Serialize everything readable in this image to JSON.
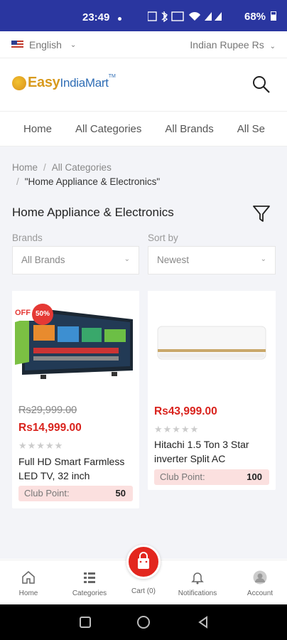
{
  "status_bar": {
    "time": "23:49",
    "battery": "68%",
    "icons": [
      "notification-dot",
      "network-speed-icon",
      "bluetooth-icon",
      "hd-voice-icon",
      "wifi-icon",
      "signal-icon",
      "signal-icon",
      "battery-icon"
    ]
  },
  "top_bar": {
    "language": "English",
    "currency": "Indian Rupee Rs"
  },
  "header": {
    "logo_easy": "Easy",
    "logo_india": "IndiaMart",
    "logo_tm": "TM"
  },
  "nav_tabs": [
    "Home",
    "All Categories",
    "All Brands",
    "All Se"
  ],
  "breadcrumb": {
    "home": "Home",
    "categories": "All Categories",
    "current": "\"Home Appliance & Electronics\""
  },
  "page_title": "Home Appliance & Electronics",
  "filters": {
    "brands_label": "Brands",
    "brands_value": "All Brands",
    "sort_label": "Sort by",
    "sort_value": "Newest"
  },
  "products": [
    {
      "name": "Full HD Smart Farmless LED TV, 32 inch",
      "old_price": "Rs29,999.00",
      "price": "Rs14,999.00",
      "rating": 0,
      "off_label": "OFF",
      "discount": "50%",
      "club_point_label": "Club Point:",
      "club_point": "50"
    },
    {
      "name": "Hitachi 1.5 Ton 3 Star inverter Split AC",
      "price": "Rs43,999.00",
      "rating": 0,
      "club_point_label": "Club Point:",
      "club_point": "100"
    }
  ],
  "bottom_nav": {
    "home": "Home",
    "categories": "Categories",
    "cart": "Cart (0)",
    "notifications": "Notifications",
    "account": "Account"
  },
  "colors": {
    "status_bar": "#2a36a0",
    "accent_red": "#e3261e",
    "background": "#f3f4f8"
  }
}
